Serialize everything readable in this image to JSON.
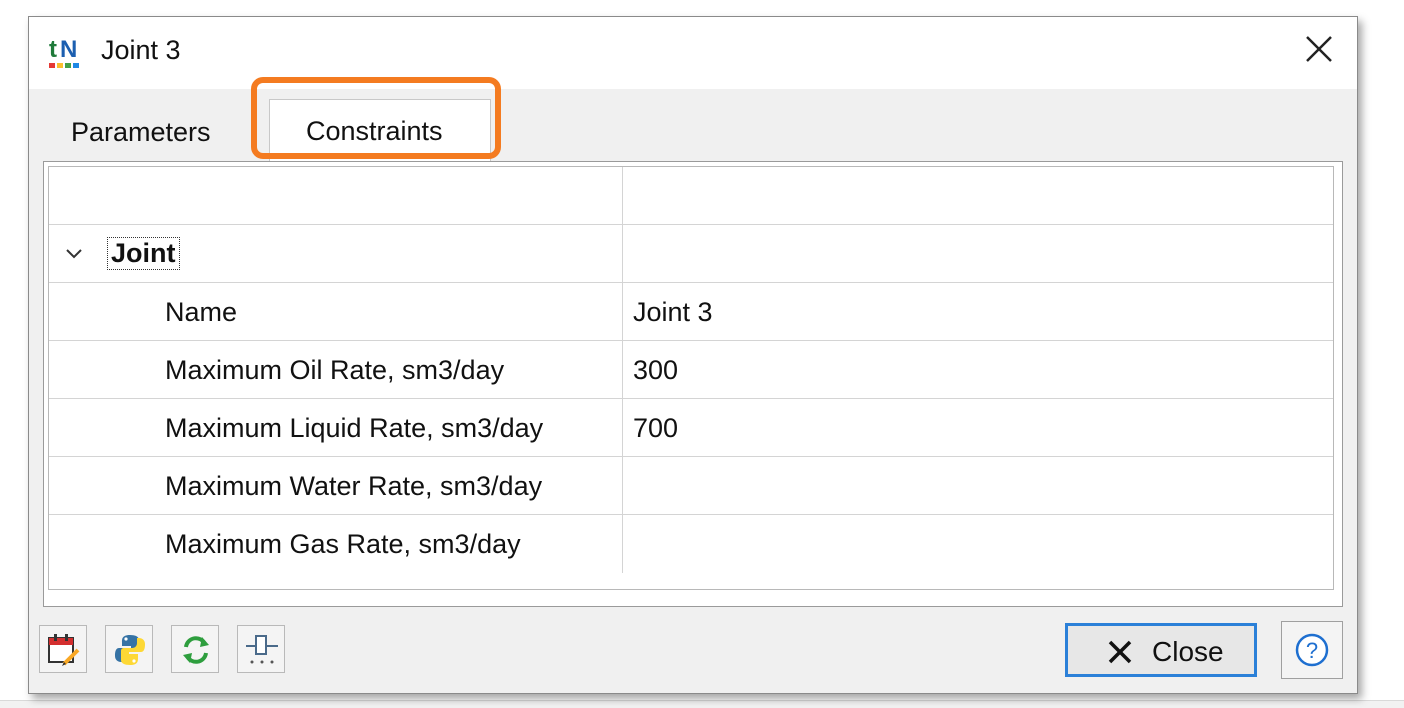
{
  "window": {
    "title": "Joint 3",
    "accent_color": "#2b80d8",
    "highlight_color": "#f47b20"
  },
  "tabs": [
    {
      "label": "Parameters",
      "selected": false
    },
    {
      "label": "Constraints",
      "selected": true
    }
  ],
  "grid": {
    "group": {
      "label": "Joint",
      "expanded": true
    },
    "rows": [
      {
        "label": "Name",
        "value": "Joint 3"
      },
      {
        "label": "Maximum Oil Rate, sm3/day",
        "value": "300"
      },
      {
        "label": "Maximum Liquid Rate, sm3/day",
        "value": "700"
      },
      {
        "label": "Maximum Water Rate, sm3/day",
        "value": ""
      },
      {
        "label": "Maximum Gas Rate, sm3/day",
        "value": ""
      }
    ]
  },
  "footer": {
    "tools": [
      "calendar-edit-icon",
      "python-icon",
      "refresh-icon",
      "slider-icon"
    ],
    "close_label": "Close",
    "help_icon": "help-icon"
  }
}
